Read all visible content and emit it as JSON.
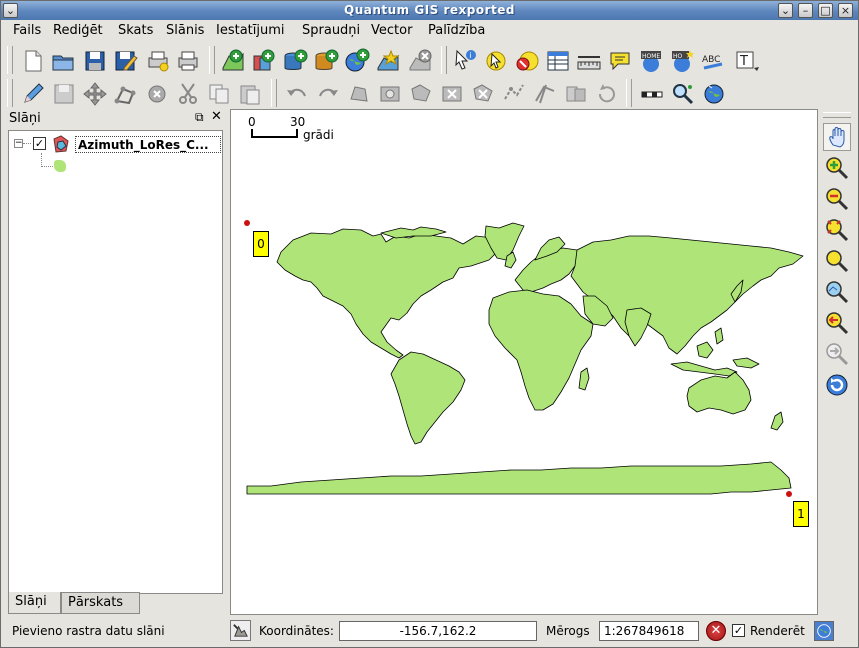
{
  "window": {
    "title": "Quantum GIS rexported"
  },
  "menu": [
    "Fails",
    "Rediģēt",
    "Skats",
    "Slānis",
    "Iestatījumi",
    "Spraudņi",
    "Vector",
    "Palīdzība"
  ],
  "layers_panel": {
    "title": "Slāņi",
    "layer_name": "Azimuth_LoRes_C...",
    "tabs": [
      "Slāņi",
      "Pārskats"
    ]
  },
  "scalebar": {
    "left_tick": "0",
    "right_tick": "30",
    "unit": "grādi"
  },
  "labels": {
    "label_0": "0",
    "label_1": "1"
  },
  "status": {
    "message": "Pievieno rastra datu slāni",
    "coords_label": "Koordinātes:",
    "coords_value": "-156.7,162.2",
    "scale_label": "Mērogs",
    "scale_value": "1:267849618",
    "render_label": "Renderēt"
  },
  "colors": {
    "land": "#aee478",
    "label_bg": "#ffff00",
    "marker": "#cc1111"
  }
}
